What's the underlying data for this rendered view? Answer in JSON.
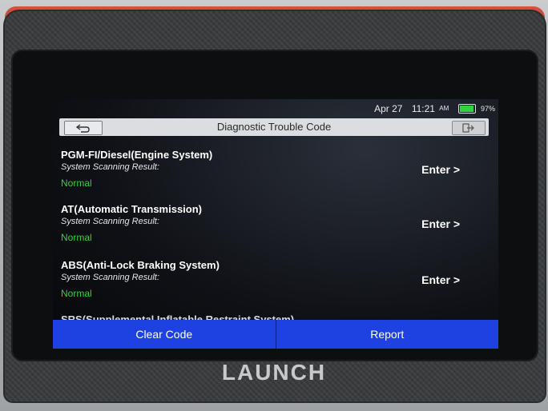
{
  "status": {
    "date": "Apr 27",
    "time": "11:21",
    "ampm": "AM",
    "battery": "97%"
  },
  "header": {
    "title": "Diagnostic Trouble Code"
  },
  "systems": [
    {
      "name": "PGM-FI/Diesel(Engine System)",
      "subtitle": "System Scanning Result:",
      "status": "Normal",
      "enter_label": "Enter >"
    },
    {
      "name": "AT(Automatic Transmission)",
      "subtitle": "System Scanning Result:",
      "status": "Normal",
      "enter_label": "Enter >"
    },
    {
      "name": "ABS(Anti-Lock Braking System)",
      "subtitle": "System Scanning Result:",
      "status": "Normal",
      "enter_label": "Enter >"
    }
  ],
  "partial_item": "SRS(Supplemental Inflatable Restraint System)",
  "bottom": {
    "clear_code": "Clear Code",
    "report": "Report"
  },
  "brand": "LAUNCH",
  "colors": {
    "normal_status": "#3ad03d",
    "bottom_bar": "#1d42e1",
    "device_accent": "#c8442f"
  }
}
